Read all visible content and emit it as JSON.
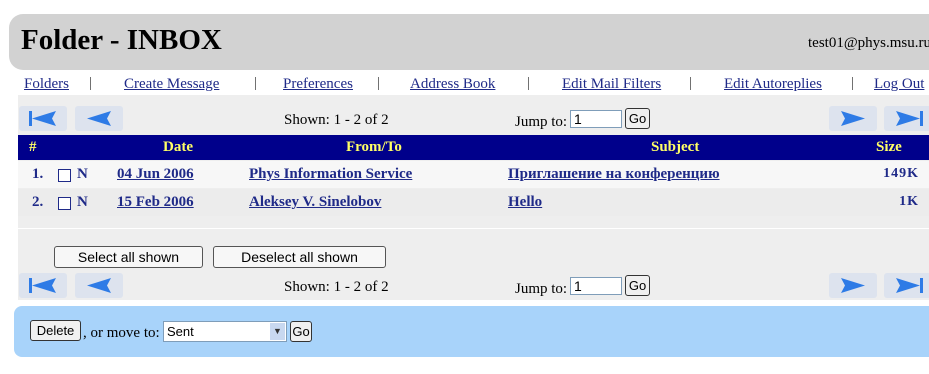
{
  "header": {
    "title": "Folder - INBOX",
    "user": "test01@phys.msu.ru"
  },
  "nav": [
    {
      "label": "Folders"
    },
    {
      "label": "Create Message"
    },
    {
      "label": "Preferences"
    },
    {
      "label": "Address Book"
    },
    {
      "label": "Edit Mail Filters"
    },
    {
      "label": "Edit Autoreplies"
    },
    {
      "label": "Log Out"
    }
  ],
  "pager": {
    "shown": "Shown: 1 - 2 of 2",
    "jump_label": "Jump to:",
    "jump_value": "1",
    "go_label": "Go"
  },
  "table": {
    "headers": {
      "num": "#",
      "date": "Date",
      "from": "From/To",
      "subject": "Subject",
      "size": "Size"
    },
    "rows": [
      {
        "num": "1.",
        "flag": "N",
        "date": "04 Jun 2006",
        "from": "Phys Information Service",
        "subject": "Приглашение на конференцию",
        "size": "149K"
      },
      {
        "num": "2.",
        "flag": "N",
        "date": "15 Feb 2006",
        "from": "Aleksey V. Sinelobov",
        "subject": "Hello",
        "size": "1K"
      }
    ]
  },
  "buttons": {
    "select_all": "Select all shown",
    "deselect_all": "Deselect all shown"
  },
  "actions": {
    "delete": "Delete",
    "move_text": ", or move to:",
    "move_target": "Sent",
    "go": "Go"
  },
  "colors": {
    "header_bg": "#d2d2d2",
    "table_header_bg": "#00008b",
    "table_header_text": "#ffff66",
    "link": "#1f2a88",
    "action_bar_bg": "#a8d3fa",
    "arrow": "#2e7be6"
  },
  "icons": {
    "first_page": "first-page-icon",
    "prev_page": "prev-page-icon",
    "next_page": "next-page-icon",
    "last_page": "last-page-icon",
    "dropdown": "chevron-down-icon"
  }
}
